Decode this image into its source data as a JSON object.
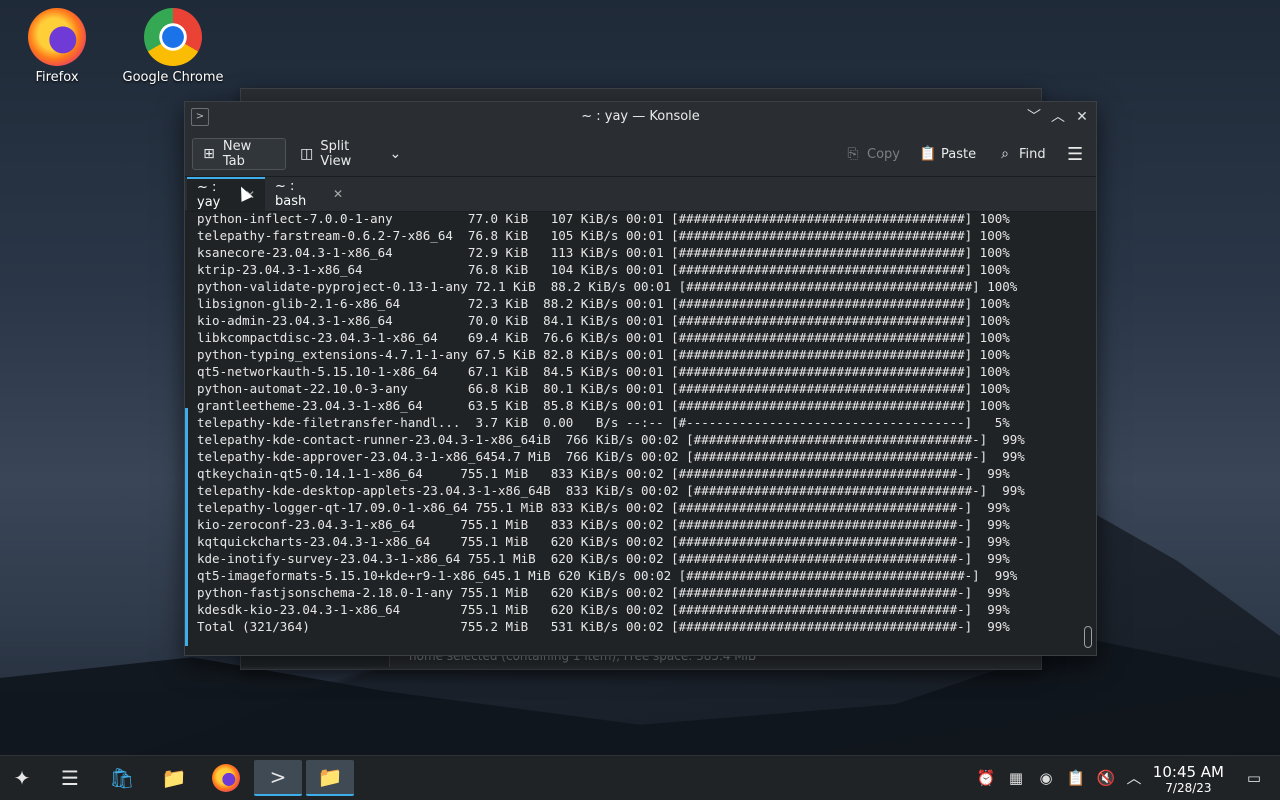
{
  "desktop": {
    "icons": [
      {
        "label": "Firefox",
        "icon": "firefox-icon"
      },
      {
        "label": "Google Chrome",
        "icon": "chrome-icon"
      }
    ]
  },
  "background_window": {
    "status_text": "home  selected (containing 1 item), Free space: 385.4 MiB"
  },
  "konsole": {
    "title": "~ : yay — Konsole",
    "toolbar": {
      "new_tab": "New Tab",
      "split_view": "Split View",
      "copy": "Copy",
      "paste": "Paste",
      "find": "Find"
    },
    "tabs": [
      {
        "label": "~ : yay",
        "active": true
      },
      {
        "label": "~ : bash",
        "active": false
      }
    ],
    "lines": [
      "python-inflect-7.0.0-1-any          77.0 KiB   107 KiB/s 00:01 [######################################] 100%",
      "telepathy-farstream-0.6.2-7-x86_64  76.8 KiB   105 KiB/s 00:01 [######################################] 100%",
      "ksanecore-23.04.3-1-x86_64          72.9 KiB   113 KiB/s 00:01 [######################################] 100%",
      "ktrip-23.04.3-1-x86_64              76.8 KiB   104 KiB/s 00:01 [######################################] 100%",
      "python-validate-pyproject-0.13-1-any 72.1 KiB  88.2 KiB/s 00:01 [######################################] 100%",
      "libsignon-glib-2.1-6-x86_64         72.3 KiB  88.2 KiB/s 00:01 [######################################] 100%",
      "kio-admin-23.04.3-1-x86_64          70.0 KiB  84.1 KiB/s 00:01 [######################################] 100%",
      "libkcompactdisc-23.04.3-1-x86_64    69.4 KiB  76.6 KiB/s 00:01 [######################################] 100%",
      "python-typing_extensions-4.7.1-1-any 67.5 KiB 82.8 KiB/s 00:01 [######################################] 100%",
      "qt5-networkauth-5.15.10-1-x86_64    67.1 KiB  84.5 KiB/s 00:01 [######################################] 100%",
      "python-automat-22.10.0-3-any        66.8 KiB  80.1 KiB/s 00:01 [######################################] 100%",
      "grantleetheme-23.04.3-1-x86_64      63.5 KiB  85.8 KiB/s 00:01 [######################################] 100%",
      "telepathy-kde-filetransfer-handl...  3.7 KiB  0.00   B/s --:-- [#-------------------------------------]   5%",
      "telepathy-kde-contact-runner-23.04.3-1-x86_64iB  766 KiB/s 00:02 [#####################################-]  99%",
      "telepathy-kde-approver-23.04.3-1-x86_6454.7 MiB  766 KiB/s 00:02 [#####################################-]  99%",
      "qtkeychain-qt5-0.14.1-1-x86_64     755.1 MiB   833 KiB/s 00:02 [#####################################-]  99%",
      "telepathy-kde-desktop-applets-23.04.3-1-x86_64B  833 KiB/s 00:02 [#####################################-]  99%",
      "telepathy-logger-qt-17.09.0-1-x86_64 755.1 MiB 833 KiB/s 00:02 [#####################################-]  99%",
      "kio-zeroconf-23.04.3-1-x86_64      755.1 MiB   833 KiB/s 00:02 [#####################################-]  99%",
      "kqtquickcharts-23.04.3-1-x86_64    755.1 MiB   620 KiB/s 00:02 [#####################################-]  99%",
      "kde-inotify-survey-23.04.3-1-x86_64 755.1 MiB  620 KiB/s 00:02 [#####################################-]  99%",
      "qt5-imageformats-5.15.10+kde+r9-1-x86_645.1 MiB 620 KiB/s 00:02 [#####################################-]  99%",
      "python-fastjsonschema-2.18.0-1-any 755.1 MiB   620 KiB/s 00:02 [#####################################-]  99%",
      "kdesdk-kio-23.04.3-1-x86_64        755.1 MiB   620 KiB/s 00:02 [#####################################-]  99%",
      "Total (321/364)                    755.2 MiB   531 KiB/s 00:02 [#####################################-]  99%"
    ]
  },
  "taskbar": {
    "clock_time": "10:45 AM",
    "clock_date": "7/28/23",
    "accent": "#3daee9"
  }
}
